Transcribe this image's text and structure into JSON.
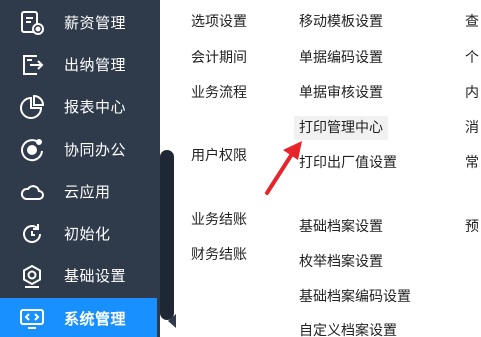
{
  "sidebar": {
    "items": [
      {
        "label": "薪资管理",
        "icon": "payroll-icon"
      },
      {
        "label": "出纳管理",
        "icon": "cashier-icon"
      },
      {
        "label": "报表中心",
        "icon": "pie-chart-icon"
      },
      {
        "label": "协同办公",
        "icon": "collaboration-icon"
      },
      {
        "label": "云应用",
        "icon": "cloud-icon"
      },
      {
        "label": "初始化",
        "icon": "reset-icon"
      },
      {
        "label": "基础设置",
        "icon": "settings-icon"
      },
      {
        "label": "系统管理",
        "icon": "monitor-code-icon",
        "active": true
      }
    ],
    "colors": {
      "background": "#2f3b4b",
      "active": "#1890ff"
    }
  },
  "menu": {
    "col1": [
      "选项设置",
      "会计期间",
      "业务流程",
      "用户权限",
      "业务结账",
      "财务结账"
    ],
    "col2": [
      "移动模板设置",
      "单据编码设置",
      "单据审核设置",
      "打印管理中心",
      "打印出厂值设置",
      "基础档案设置",
      "枚举档案设置",
      "基础档案编码设置",
      "自定义档案设置"
    ],
    "col3": [
      "查",
      "个",
      "内",
      "消",
      "常",
      "预"
    ],
    "highlighted": "打印管理中心"
  },
  "annotation": {
    "arrow_color": "#e8232a"
  }
}
